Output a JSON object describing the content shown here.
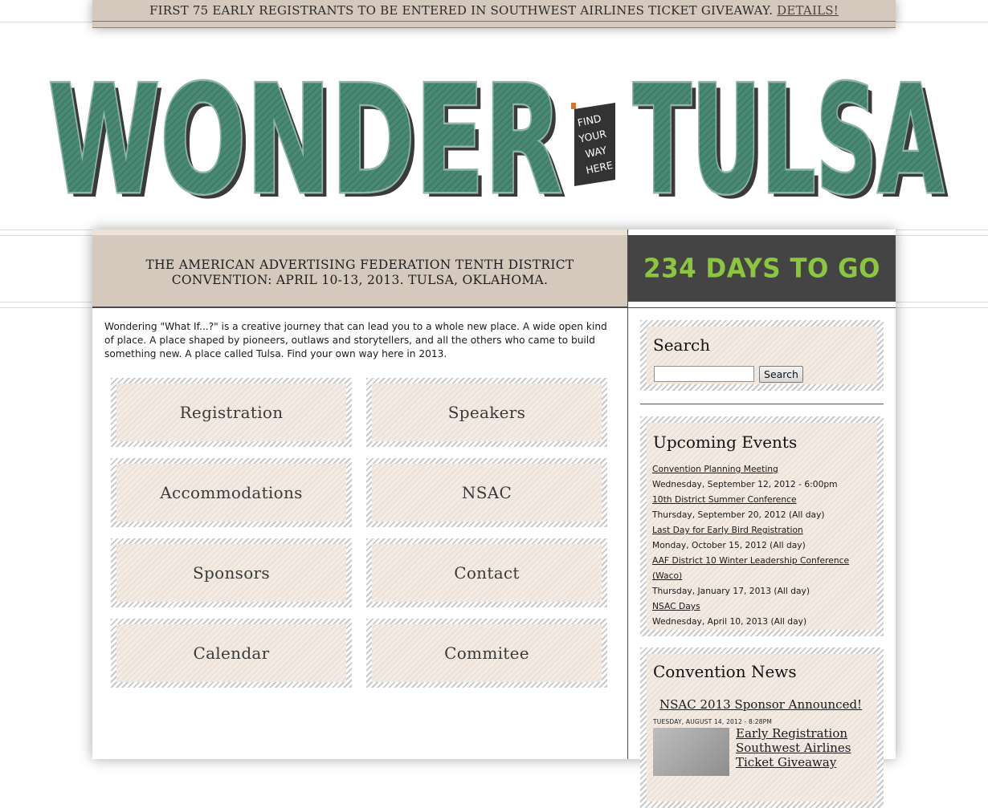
{
  "promo": {
    "text": "FIRST 75 EARLY REGISTRANTS TO BE ENTERED IN SOUTHWEST AIRLINES TICKET GIVEAWAY.",
    "link": "DETAILS!"
  },
  "logo": {
    "left_word": "WONDER",
    "right_word": "TULSA",
    "ribbon": [
      "FIND",
      "YOUR",
      "WAY",
      "HERE"
    ],
    "colors": {
      "fill": "#4a8a74",
      "outline": "#8fb5a3",
      "shadow": "#3a3a3a",
      "ribbon": "#333333",
      "ribbon_accent": "#d4772c"
    }
  },
  "header": {
    "tagline": "THE AMERICAN ADVERTISING FEDERATION TENTH DISTRICT CONVENTION: APRIL 10-13, 2013. TULSA, OKLAHOMA.",
    "countdown": "234 DAYS TO GO",
    "countdown_color": "#8cc63f"
  },
  "intro": "Wondering \"What If...?\" is a creative journey that can lead you to a whole new place. A wide open kind of place. A place shaped by pioneers, outlaws and storytellers, and all the others who came to build something new. A place called Tulsa. Find your own way here in 2013.",
  "nav": [
    {
      "label": "Registration"
    },
    {
      "label": "Speakers"
    },
    {
      "label": "Accommodations"
    },
    {
      "label": "NSAC"
    },
    {
      "label": "Sponsors"
    },
    {
      "label": "Contact"
    },
    {
      "label": "Calendar"
    },
    {
      "label": "Commitee"
    }
  ],
  "sidebar": {
    "search": {
      "title": "Search",
      "input_value": "",
      "button_label": "Search"
    },
    "events": {
      "title": "Upcoming Events",
      "items": [
        {
          "name": "Convention Planning Meeting",
          "when": "Wednesday, September 12, 2012 - 6:00pm"
        },
        {
          "name": "10th District Summer Conference",
          "when": "Thursday, September 20, 2012 (All day)"
        },
        {
          "name": "Last Day for Early Bird Registration",
          "when": "Monday, October 15, 2012 (All day)"
        },
        {
          "name": "AAF District 10 Winter Leadership Conference (Waco)",
          "when": "Thursday, January 17, 2013 (All day)"
        },
        {
          "name": "NSAC Days",
          "when": "Wednesday, April 10, 2013 (All day)"
        }
      ]
    },
    "news": {
      "title": "Convention News",
      "headline": "NSAC 2013 Sponsor Announced!",
      "date": "TUESDAY, AUGUST 14, 2012 - 8:28PM",
      "item2": "Early Registration Southwest Airlines Ticket Giveaway"
    }
  }
}
